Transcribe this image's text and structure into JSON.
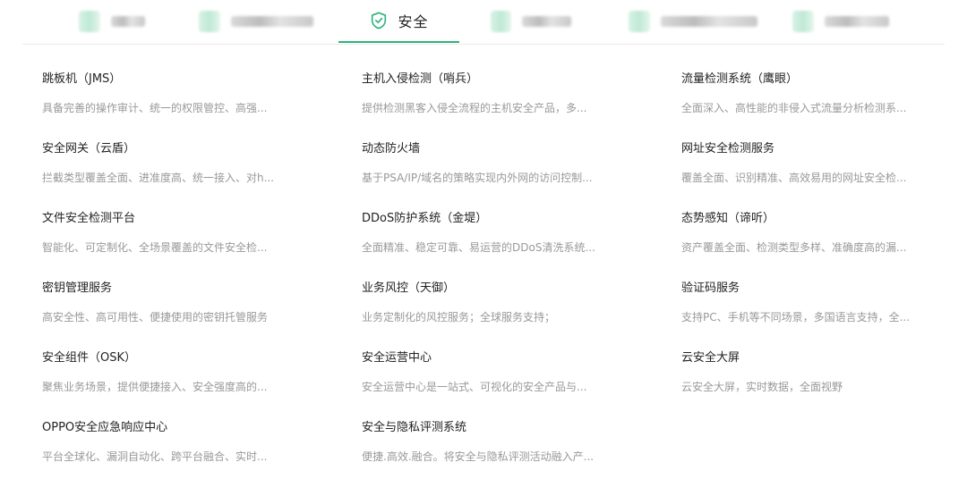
{
  "nav": {
    "active_tab": "安全",
    "accent_color": "#2db37a",
    "blurred_tab_count": 5
  },
  "products": [
    [
      {
        "title": "跳板机（JMS）",
        "desc": "具备完善的操作审计、统一的权限管控、高强..."
      },
      {
        "title": "安全网关（云盾）",
        "desc": "拦截类型覆盖全面、进准度高、统一接入、对h..."
      },
      {
        "title": "文件安全检测平台",
        "desc": "智能化、可定制化、全场景覆盖的文件安全检..."
      },
      {
        "title": "密钥管理服务",
        "desc": "高安全性、高可用性、便捷使用的密钥托管服务"
      },
      {
        "title": "安全组件（OSK）",
        "desc": "聚焦业务场景，提供便捷接入、安全强度高的..."
      },
      {
        "title": "OPPO安全应急响应中心",
        "desc": "平台全球化、漏洞自动化、跨平台融合、实时..."
      }
    ],
    [
      {
        "title": "主机入侵检测（哨兵）",
        "desc": "提供检测黑客入侵全流程的主机安全产品，多..."
      },
      {
        "title": "动态防火墙",
        "desc": "基于PSA/IP/域名的策略实现内外网的访问控制..."
      },
      {
        "title": "DDoS防护系统（金堤）",
        "desc": "全面精准、稳定可靠、易运营的DDoS清洗系统..."
      },
      {
        "title": "业务风控（天御）",
        "desc": "业务定制化的风控服务；全球服务支持；"
      },
      {
        "title": "安全运营中心",
        "desc": "安全运营中心是一站式、可视化的安全产品与..."
      },
      {
        "title": "安全与隐私评测系统",
        "desc": "便捷.高效.融合。将安全与隐私评测活动融入产..."
      }
    ],
    [
      {
        "title": "流量检测系统（鹰眼）",
        "desc": "全面深入、高性能的非侵入式流量分析检测系..."
      },
      {
        "title": "网址安全检测服务",
        "desc": "覆盖全面、识别精准、高效易用的网址安全检..."
      },
      {
        "title": "态势感知（谛听）",
        "desc": "资产覆盖全面、检测类型多样、准确度高的漏..."
      },
      {
        "title": "验证码服务",
        "desc": "支持PC、手机等不同场景，多国语言支持，全..."
      },
      {
        "title": "云安全大屏",
        "desc": "云安全大屏，实时数据，全面视野"
      }
    ]
  ]
}
